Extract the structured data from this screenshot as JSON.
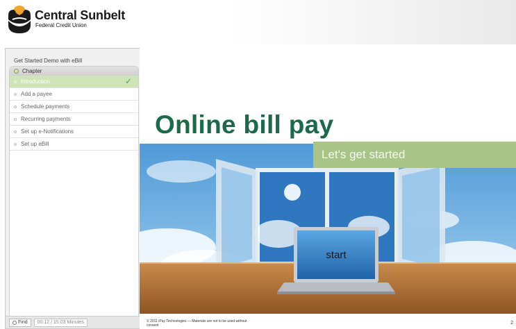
{
  "brand": {
    "name": "Central Sunbelt",
    "subtitle": "Federal Credit Union"
  },
  "sidebar": {
    "title": "Get Started Demo with eBill",
    "chapter_label": "Chapter",
    "items": [
      {
        "label": "Introduction",
        "active": true
      },
      {
        "label": "Add a payee"
      },
      {
        "label": "Schedule payments"
      },
      {
        "label": "Recurring payments"
      },
      {
        "label": "Set up e-Notifications"
      },
      {
        "label": "Set up eBill"
      }
    ],
    "find_label": "Find",
    "time": "00:12 / 15:03 Minutes"
  },
  "slide": {
    "title": "Online bill pay",
    "subtitle": "Let's get started",
    "laptop_label": "start",
    "copyright": "© 2011 iPay Technologies — Materials are not to be used without consent",
    "page_number": "2"
  },
  "colors": {
    "title_green": "#1c6a4a",
    "band_green": "#a9c487",
    "active_item": "#cfe5b8"
  }
}
